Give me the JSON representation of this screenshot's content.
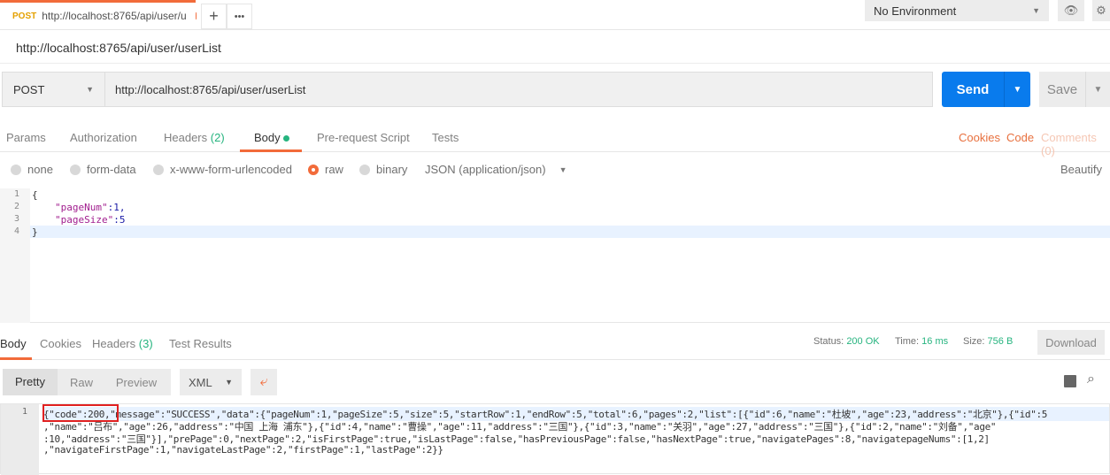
{
  "tab": {
    "method": "POST",
    "title": "http://localhost:8765/api/user/u",
    "new_tab": "+",
    "more": "•••"
  },
  "environment": {
    "selected": "No Environment"
  },
  "request": {
    "title": "http://localhost:8765/api/user/userList",
    "method": "POST",
    "url": "http://localhost:8765/api/user/userList",
    "send": "Send",
    "save": "Save"
  },
  "req_tabs": [
    "Params",
    "Authorization",
    "Headers",
    "(2)",
    "Body",
    "Pre-request Script",
    "Tests"
  ],
  "req_links": {
    "cookies": "Cookies",
    "code": "Code",
    "comments": "Comments (0)"
  },
  "body_modes": [
    "none",
    "form-data",
    "x-www-form-urlencoded",
    "raw",
    "binary"
  ],
  "body_mode_selected": "raw",
  "content_type": "JSON (application/json)",
  "beautify": "Beautify",
  "editor_lines": [
    {
      "n": "1",
      "text": "{"
    },
    {
      "n": "2",
      "key": "\"pageNum\"",
      "val": ":1,"
    },
    {
      "n": "3",
      "key": "\"pageSize\"",
      "val": ":5"
    },
    {
      "n": "4",
      "text": "}"
    }
  ],
  "resp_tabs": [
    "Body",
    "Cookies",
    "Headers",
    "(3)",
    "Test Results"
  ],
  "response_status": {
    "status_label": "Status:",
    "status": "200 OK",
    "time_label": "Time:",
    "time": "16 ms",
    "size_label": "Size:",
    "size": "756 B",
    "download": "Download"
  },
  "format": {
    "pretty": "Pretty",
    "raw": "Raw",
    "preview": "Preview",
    "type": "XML"
  },
  "response_lines": [
    "{\"code\":200,\"message\":\"SUCCESS\",\"data\":{\"pageNum\":1,\"pageSize\":5,\"size\":5,\"startRow\":1,\"endRow\":5,\"total\":6,\"pages\":2,\"list\":[{\"id\":6,\"name\":\"杜坡\",\"age\":23,\"address\":\"北京\"},{\"id\":5",
    ",\"name\":\"吕布\",\"age\":26,\"address\":\"中国 上海 浦东\"},{\"id\":4,\"name\":\"曹操\",\"age\":11,\"address\":\"三国\"},{\"id\":3,\"name\":\"关羽\",\"age\":27,\"address\":\"三国\"},{\"id\":2,\"name\":\"刘备\",\"age\"",
    ":10,\"address\":\"三国\"}],\"prePage\":0,\"nextPage\":2,\"isFirstPage\":true,\"isLastPage\":false,\"hasPreviousPage\":false,\"hasNextPage\":true,\"navigatePages\":8,\"navigatepageNums\":[1,2]",
    ",\"navigateFirstPage\":1,\"navigateLastPage\":2,\"firstPage\":1,\"lastPage\":2}}"
  ],
  "response_line_number": "1",
  "colors": {
    "accent": "#f26b3a",
    "send": "#097bed",
    "status_ok": "#26b47f",
    "highlight_box": "#e02020"
  }
}
